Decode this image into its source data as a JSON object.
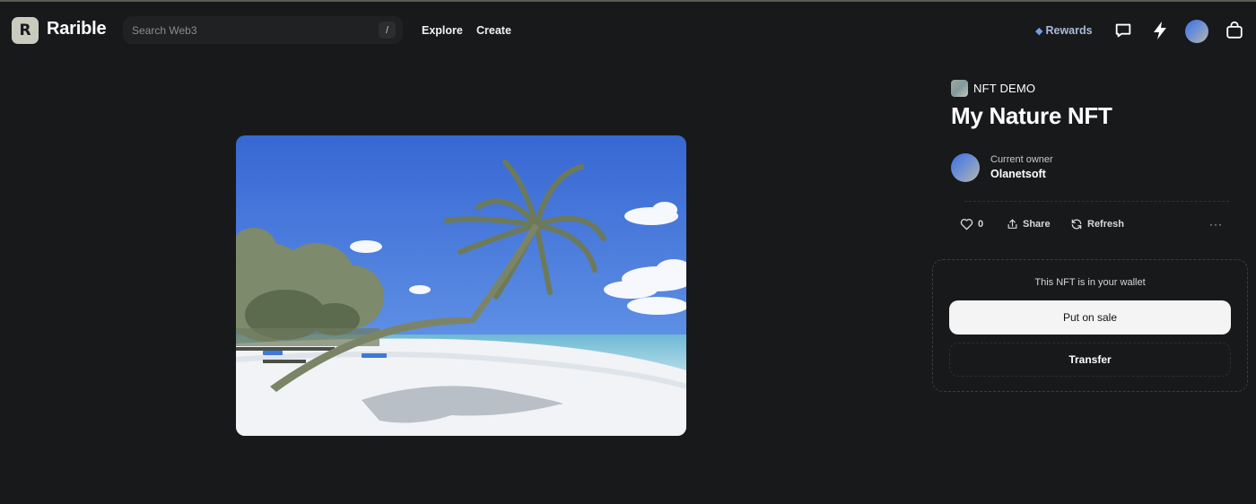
{
  "header": {
    "brand": "Rarible",
    "logo_letter": "R",
    "search": {
      "placeholder": "Search Web3",
      "shortcut": "/"
    },
    "nav": [
      "Explore",
      "Create"
    ],
    "rewards_label": "Rewards",
    "icons": [
      "logo-icon",
      "diamond-icon",
      "chat-icon",
      "lightning-icon",
      "avatar",
      "bag-icon"
    ]
  },
  "media": {
    "alt": "Tropical beach with leaning palm tree",
    "colors": {
      "sky_top": "#3a6ed8",
      "sky_bottom": "#6da0ee",
      "sand": "#f4f6f9",
      "sea": "#7fc1d6"
    }
  },
  "nft": {
    "collection": "NFT DEMO",
    "title": "My Nature NFT",
    "owner_label": "Current owner",
    "owner_name": "Olanetsoft",
    "likes": "0",
    "share_label": "Share",
    "refresh_label": "Refresh",
    "more_label": "···"
  },
  "wallet": {
    "message": "This NFT is in your wallet",
    "put_on_sale": "Put on sale",
    "transfer": "Transfer"
  },
  "colors": {
    "background": "#18191b",
    "accent": "#6f9fe8",
    "primary_button": "#f4f4f5"
  }
}
